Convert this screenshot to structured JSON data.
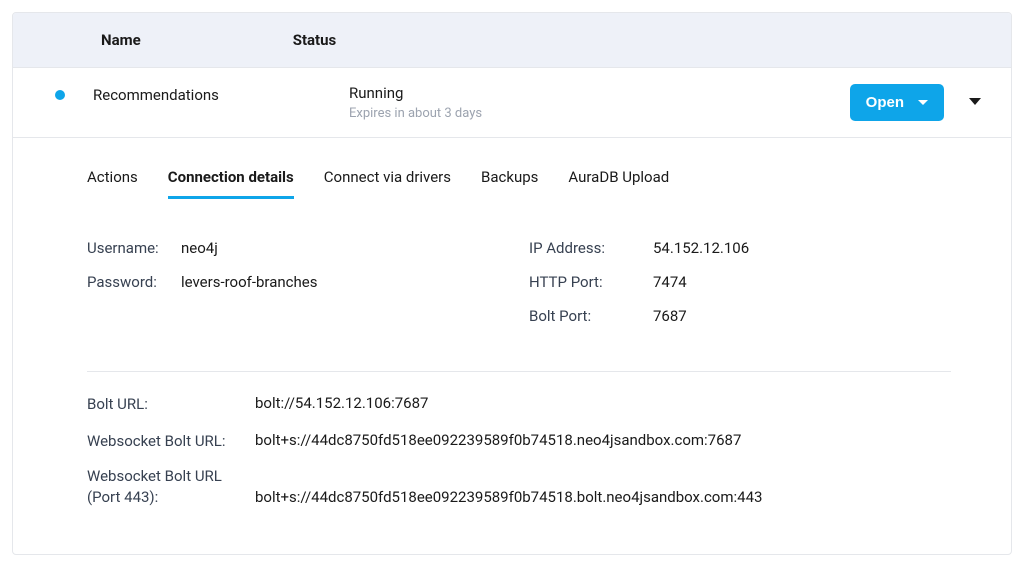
{
  "table": {
    "headers": {
      "name": "Name",
      "status": "Status"
    }
  },
  "instance": {
    "name": "Recommendations",
    "status": "Running",
    "expires": "Expires in about 3 days",
    "open_label": "Open"
  },
  "tabs": {
    "actions": "Actions",
    "connection": "Connection details",
    "drivers": "Connect via drivers",
    "backups": "Backups",
    "aura": "AuraDB Upload"
  },
  "connection": {
    "username_label": "Username:",
    "username": "neo4j",
    "password_label": "Password:",
    "password": "levers-roof-branches",
    "ip_label": "IP Address:",
    "ip": "54.152.12.106",
    "http_port_label": "HTTP Port:",
    "http_port": "7474",
    "bolt_port_label": "Bolt Port:",
    "bolt_port": "7687",
    "bolt_url_label": "Bolt URL:",
    "bolt_url": "bolt://54.152.12.106:7687",
    "ws_bolt_url_label": "Websocket Bolt URL:",
    "ws_bolt_url": "bolt+s://44dc8750fd518ee092239589f0b74518.neo4jsandbox.com:7687",
    "ws_bolt_url_443_label": "Websocket Bolt URL (Port 443):",
    "ws_bolt_url_443": "bolt+s://44dc8750fd518ee092239589f0b74518.bolt.neo4jsandbox.com:443"
  }
}
